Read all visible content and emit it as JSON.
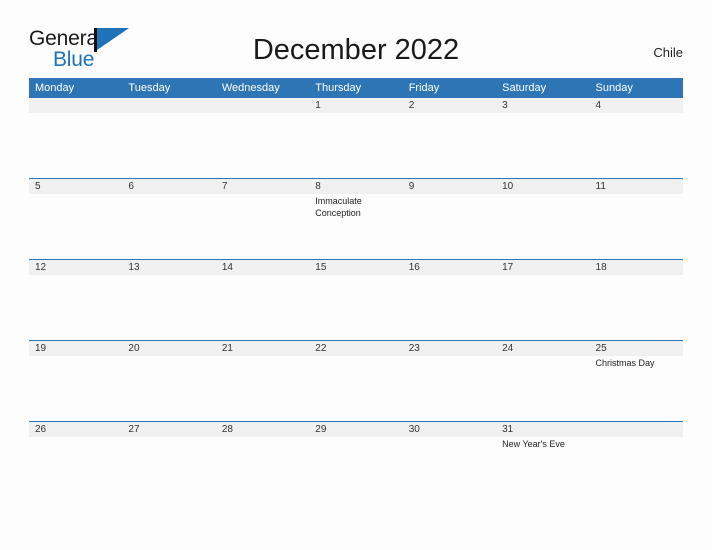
{
  "logo": {
    "word_one": "General",
    "word_two": "Blue",
    "flag_icon": "flag-triangle-icon",
    "brand_blue": "#1f72b8"
  },
  "header": {
    "title": "December 2022",
    "region": "Chile"
  },
  "calendar": {
    "header_bg": "#2e75b6",
    "band_bg": "#f0f0f0",
    "grid_line": "#2e75b6",
    "weekday_headers": [
      "Monday",
      "Tuesday",
      "Wednesday",
      "Thursday",
      "Friday",
      "Saturday",
      "Sunday"
    ],
    "weeks": [
      [
        {
          "day": "",
          "event": ""
        },
        {
          "day": "",
          "event": ""
        },
        {
          "day": "",
          "event": ""
        },
        {
          "day": "1",
          "event": ""
        },
        {
          "day": "2",
          "event": ""
        },
        {
          "day": "3",
          "event": ""
        },
        {
          "day": "4",
          "event": ""
        }
      ],
      [
        {
          "day": "5",
          "event": ""
        },
        {
          "day": "6",
          "event": ""
        },
        {
          "day": "7",
          "event": ""
        },
        {
          "day": "8",
          "event": "Immaculate Conception"
        },
        {
          "day": "9",
          "event": ""
        },
        {
          "day": "10",
          "event": ""
        },
        {
          "day": "11",
          "event": ""
        }
      ],
      [
        {
          "day": "12",
          "event": ""
        },
        {
          "day": "13",
          "event": ""
        },
        {
          "day": "14",
          "event": ""
        },
        {
          "day": "15",
          "event": ""
        },
        {
          "day": "16",
          "event": ""
        },
        {
          "day": "17",
          "event": ""
        },
        {
          "day": "18",
          "event": ""
        }
      ],
      [
        {
          "day": "19",
          "event": ""
        },
        {
          "day": "20",
          "event": ""
        },
        {
          "day": "21",
          "event": ""
        },
        {
          "day": "22",
          "event": ""
        },
        {
          "day": "23",
          "event": ""
        },
        {
          "day": "24",
          "event": ""
        },
        {
          "day": "25",
          "event": "Christmas Day"
        }
      ],
      [
        {
          "day": "26",
          "event": ""
        },
        {
          "day": "27",
          "event": ""
        },
        {
          "day": "28",
          "event": ""
        },
        {
          "day": "29",
          "event": ""
        },
        {
          "day": "30",
          "event": ""
        },
        {
          "day": "31",
          "event": "New Year's Eve"
        },
        {
          "day": "",
          "event": ""
        }
      ]
    ]
  }
}
